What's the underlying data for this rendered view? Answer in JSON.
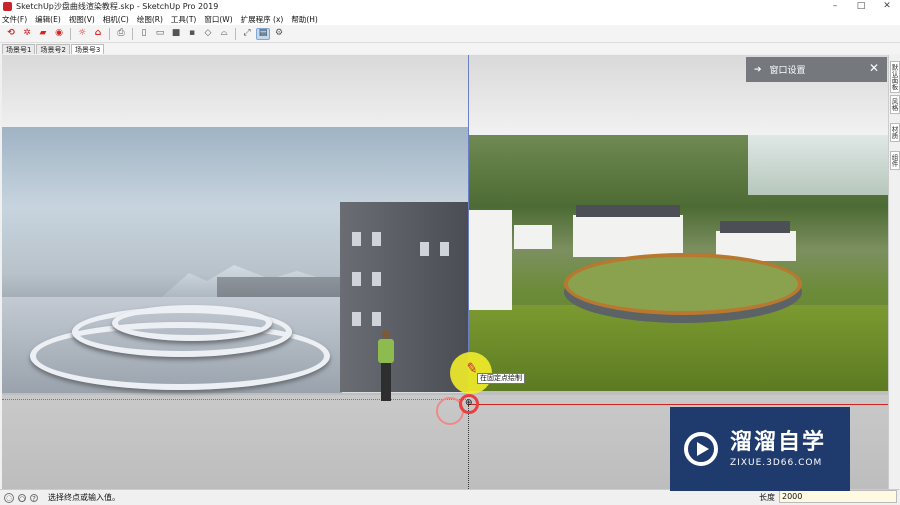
{
  "window": {
    "title": "SketchUp沙盘曲线渲染教程.skp - SketchUp Pro 2019",
    "minimize": "–",
    "maximize": "□",
    "close": "✕"
  },
  "menu": [
    "文件(F)",
    "编辑(E)",
    "视图(V)",
    "相机(C)",
    "绘图(R)",
    "工具(T)",
    "窗口(W)",
    "扩展程序 (x)",
    "帮助(H)"
  ],
  "scene_tabs": [
    "场景号1",
    "场景号2",
    "场景号3"
  ],
  "active_scene": 2,
  "panel": {
    "title": "窗口设置",
    "arrow": "➔",
    "close": "✕"
  },
  "side_tabs": [
    "默认面板",
    "风格",
    "材质",
    "组件"
  ],
  "tooltip": "在固定点绘制",
  "status": {
    "message": "选择终点或输入值。",
    "measure_label": "长度",
    "measure_value": "2000"
  },
  "watermark": {
    "brand": "溜溜自学",
    "url": "ZIXUE.3D66.COM"
  },
  "colors": {
    "axis_red": "#cc2222",
    "axis_blue": "#6b7fc4",
    "accent_yellow": "#f2ec2a",
    "watermark_bg": "#1f3a6d"
  }
}
